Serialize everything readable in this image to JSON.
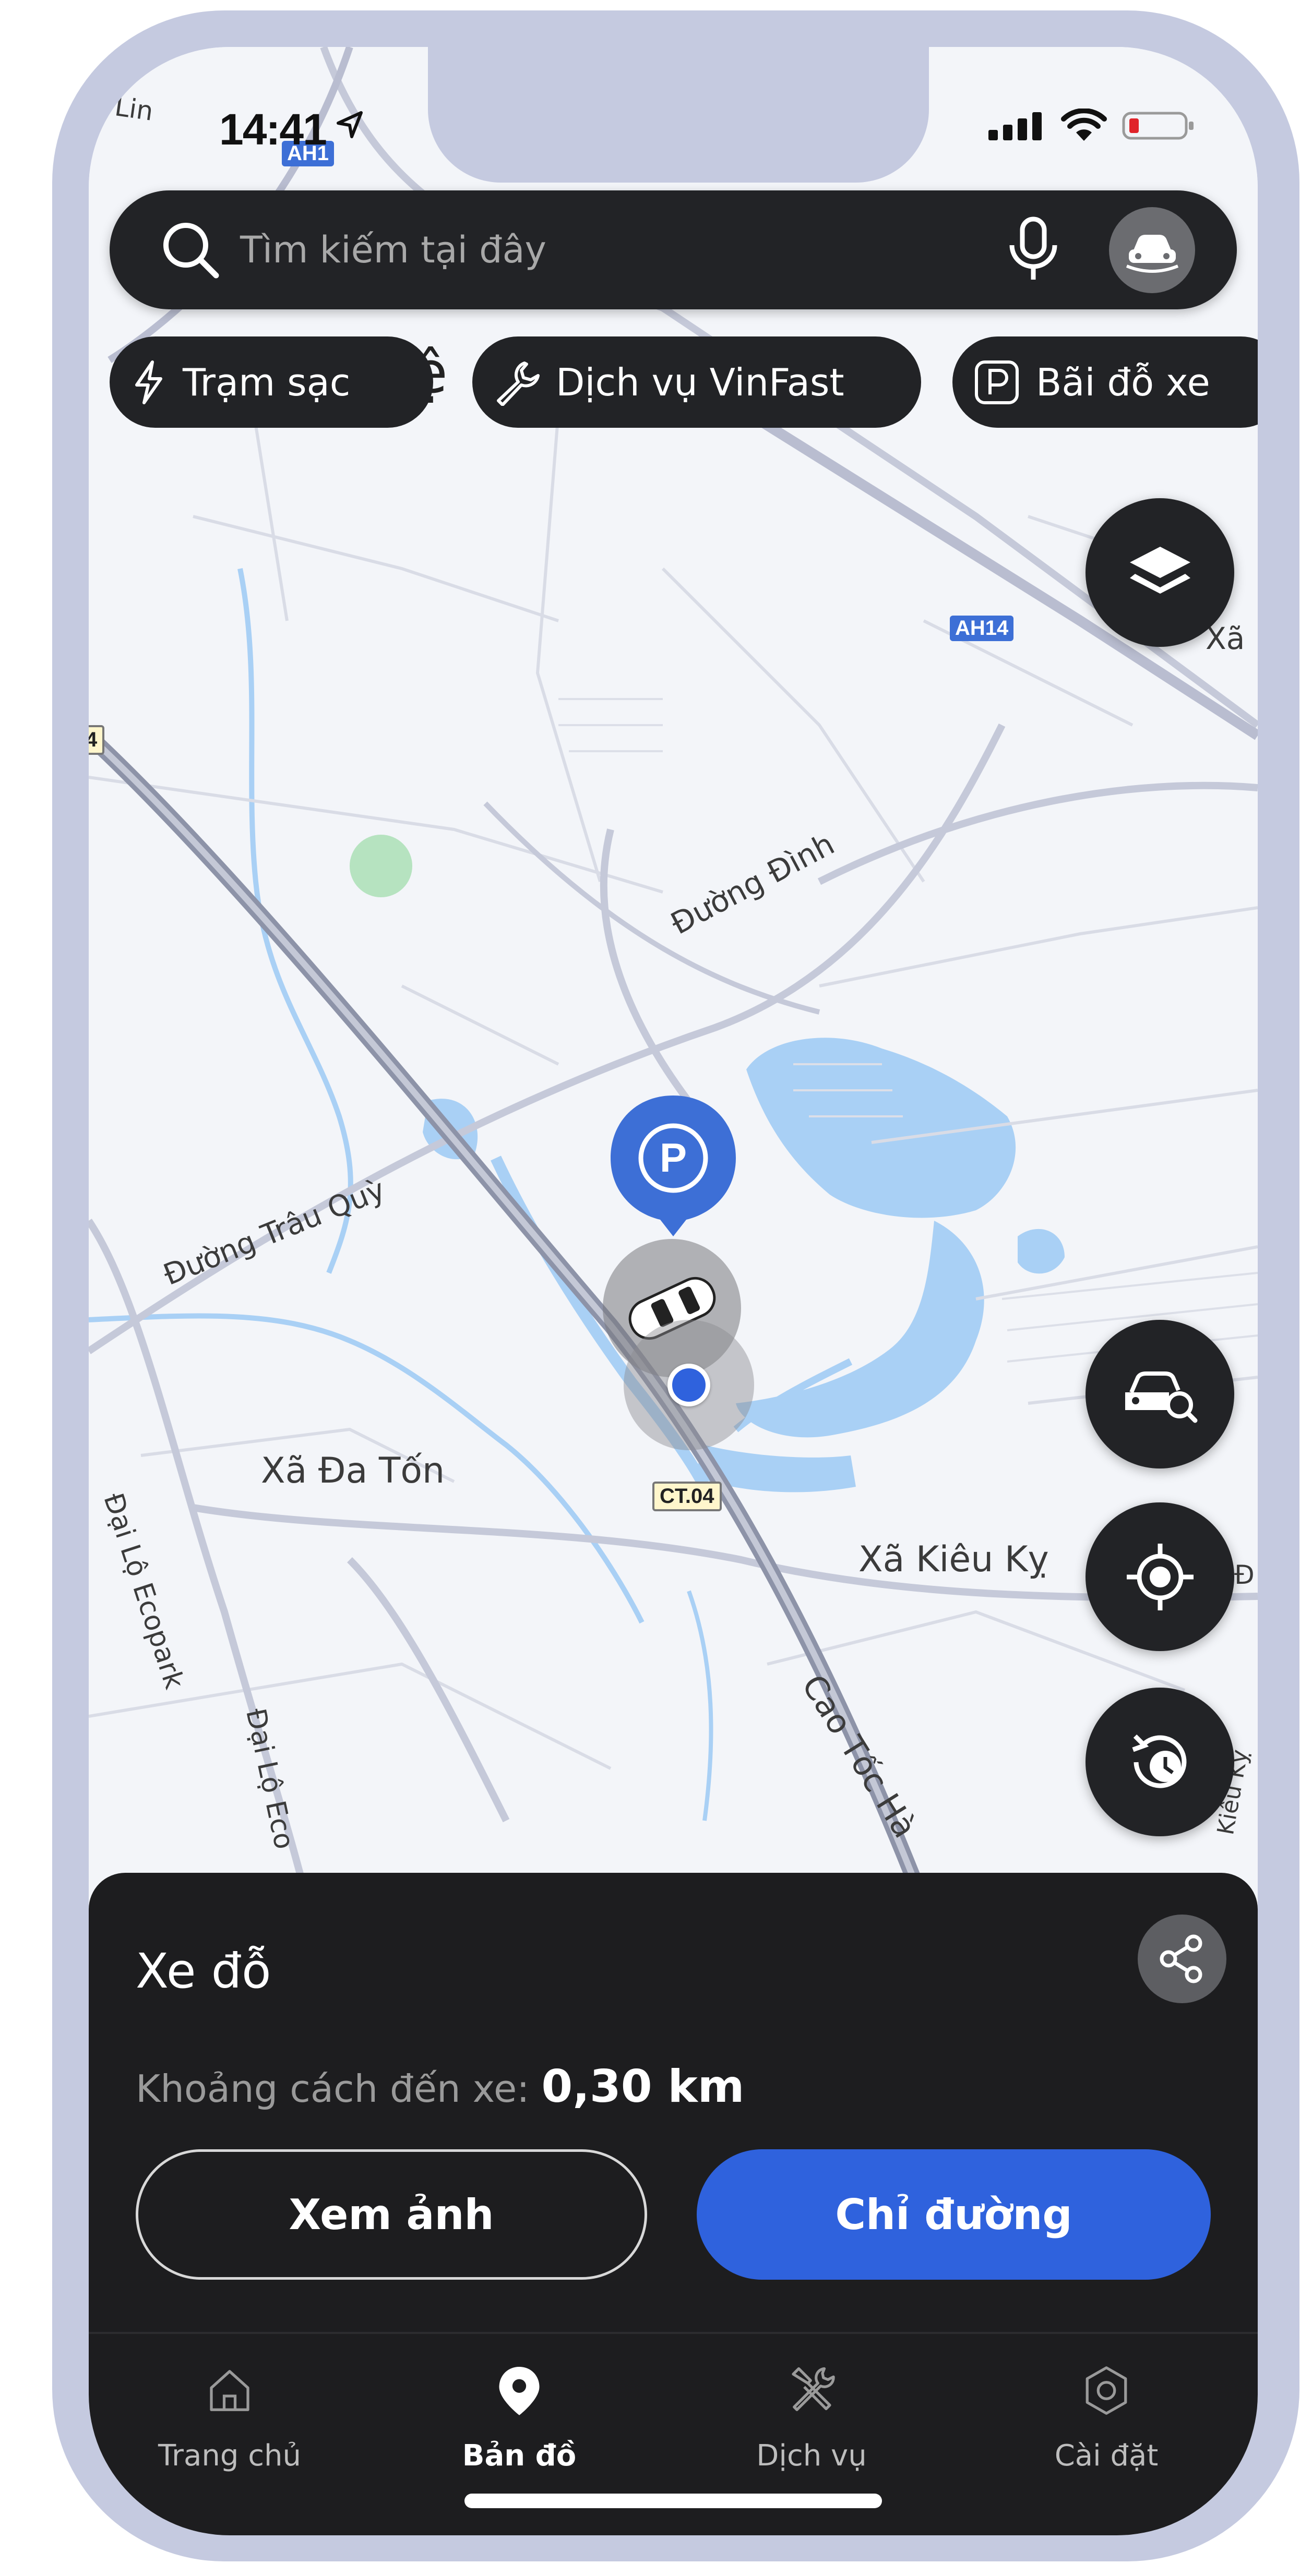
{
  "status_bar": {
    "time": "14:41"
  },
  "map": {
    "labels": {
      "road_dinh": "Đường Đình",
      "road_trau_quy": "Đường Trâu Quỳ",
      "commune_da_ton": "Xã Đa Tốn",
      "commune_kieu_ky": "Xã Kiêu Kỵ",
      "avenue_ecopark_1": "Đại Lộ Ecopark",
      "avenue_ecopark_2": "Đại Lộ Eco",
      "expressway": "Cao Tốc Hà",
      "edge_lin": "Lin",
      "edge_xa": "Xã",
      "edge_kieu": "Kiêu Kỵ",
      "edge_e": "ệ",
      "edge_d": "Đ",
      "edge_4": "4"
    },
    "shields": {
      "ah1": "AH1",
      "ah14": "AH14",
      "ct04": "CT.04"
    }
  },
  "search": {
    "placeholder": "Tìm kiếm tại đây"
  },
  "chips": [
    {
      "label": "Trạm sạc",
      "icon": "lightning-icon"
    },
    {
      "label": "Dịch vụ VinFast",
      "icon": "wrench-icon"
    },
    {
      "label": "Bãi đỗ xe",
      "icon": "parking-icon"
    }
  ],
  "sheet": {
    "title": "Xe đỗ",
    "distance_label": "Khoảng cách đến xe:",
    "distance_value": "0,30 km",
    "view_photo_label": "Xem ảnh",
    "directions_label": "Chỉ đường"
  },
  "bottom_nav": [
    {
      "label": "Trang chủ",
      "icon": "home-icon",
      "active": false
    },
    {
      "label": "Bản đồ",
      "icon": "map-pin-icon",
      "active": true
    },
    {
      "label": "Dịch vụ",
      "icon": "tools-icon",
      "active": false
    },
    {
      "label": "Cài đặt",
      "icon": "gear-icon",
      "active": false
    }
  ],
  "colors": {
    "primary": "#2f62dd",
    "sheet_bg": "#1d1d1f",
    "chip_bg": "#222326",
    "water": "#a9d0f5",
    "marker": "#3d6fd6"
  }
}
